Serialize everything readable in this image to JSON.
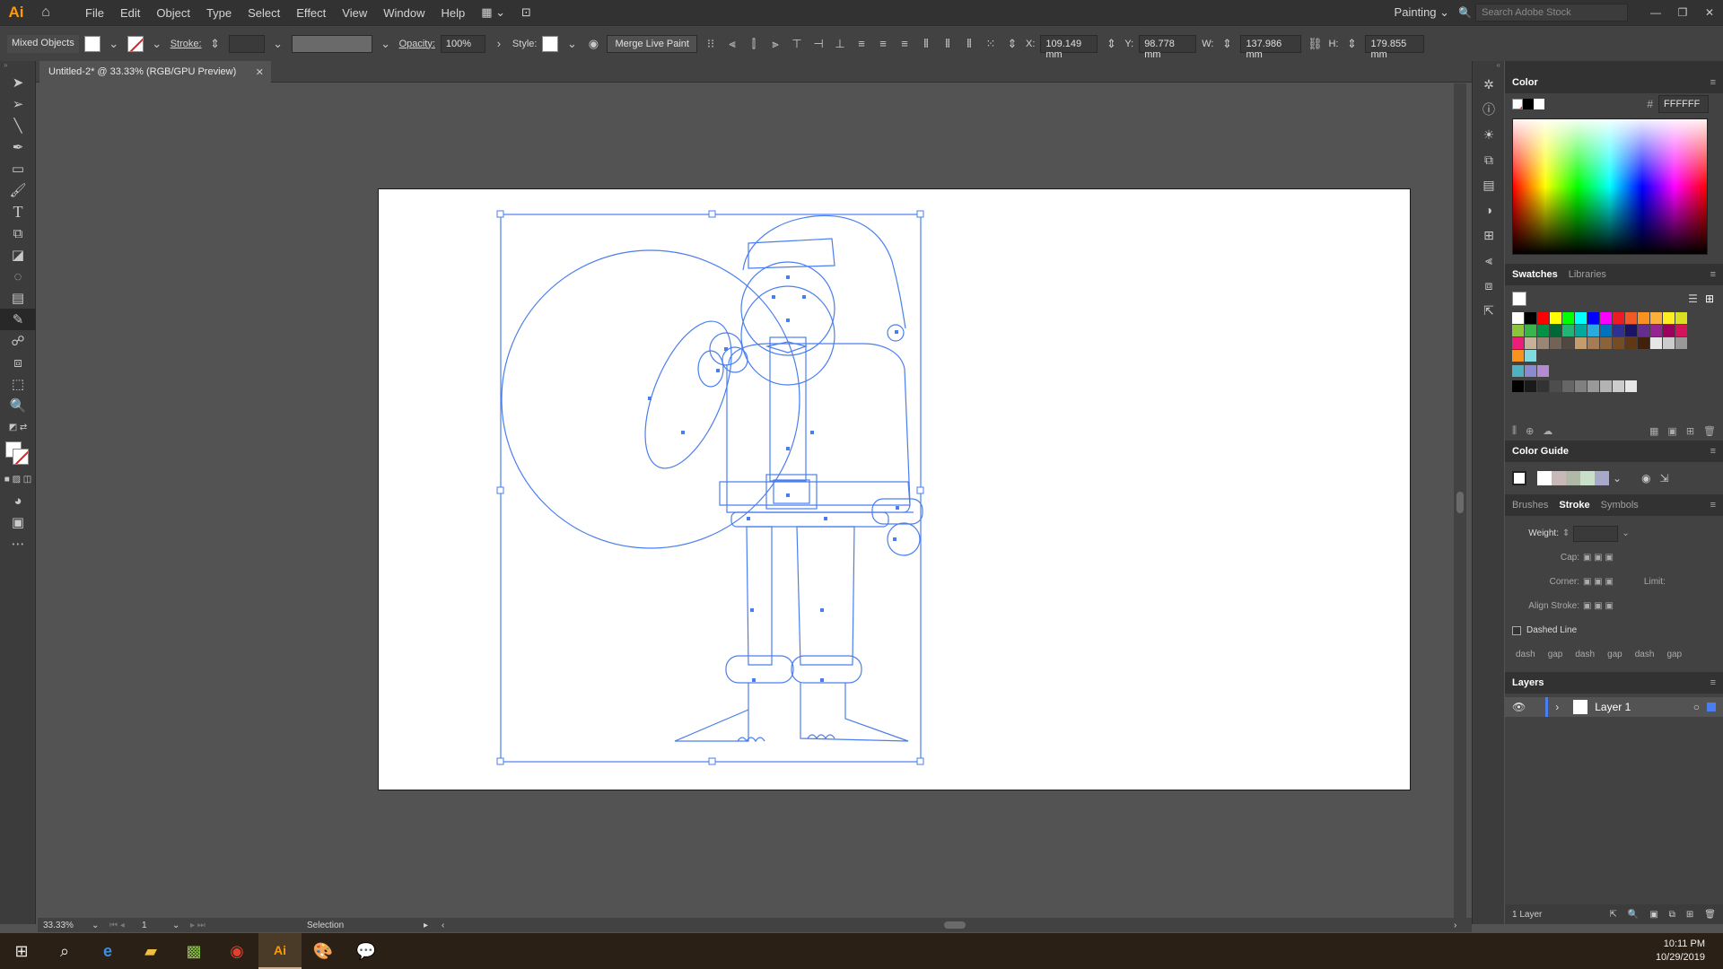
{
  "app": {
    "logo_text": "Ai",
    "menu": [
      "File",
      "Edit",
      "Object",
      "Type",
      "Select",
      "Effect",
      "View",
      "Window",
      "Help"
    ],
    "workspace": "Painting",
    "search_placeholder": "Search Adobe Stock"
  },
  "control_bar": {
    "selection_type": "Mixed Objects",
    "stroke_label": "Stroke:",
    "opacity_label": "Opacity:",
    "opacity_value": "100%",
    "style_label": "Style:",
    "merge_button": "Merge Live Paint",
    "x_label": "X:",
    "x_value": "109.149 mm",
    "y_label": "Y:",
    "y_value": "98.778 mm",
    "w_label": "W:",
    "w_value": "137.986 mm",
    "h_label": "H:",
    "h_value": "179.855 mm"
  },
  "document": {
    "tab_title": "Untitled-2* @ 33.33% (RGB/GPU Preview)",
    "zoom": "33.33%",
    "artboard_number": "1",
    "status_tool": "Selection"
  },
  "color_panel": {
    "title": "Color",
    "hex_label": "#",
    "hex_value": "FFFFFF"
  },
  "swatches_panel": {
    "tabs": [
      "Swatches",
      "Libraries"
    ],
    "colors": [
      "#ffffff",
      "#000000",
      "#ff0000",
      "#ffff00",
      "#00ff00",
      "#00ffff",
      "#0000ff",
      "#ff00ff",
      "#ed1c24",
      "#f15a24",
      "#f7931e",
      "#fbb03b",
      "#fcee21",
      "#d9e021",
      "#8cc63f",
      "#39b54a",
      "#009245",
      "#006837",
      "#22b573",
      "#00a99d",
      "#29abe2",
      "#0071bc",
      "#2e3192",
      "#1b1464",
      "#662d91",
      "#93278f",
      "#9e005d",
      "#d4145a",
      "#ed1e79",
      "#c7b299",
      "#998675",
      "#736357",
      "#534741",
      "#c69c6d",
      "#a67c52",
      "#8c6239",
      "#754c24",
      "#603813",
      "#42210b",
      "#e6e6e6",
      "#cccccc",
      "#999999",
      "#f7931e",
      "#7fdbe0"
    ],
    "group_colors": [
      "#4fb3bf",
      "#8a8ad0",
      "#b48ad0"
    ],
    "grays": [
      "#000000",
      "#1a1a1a",
      "#333333",
      "#4d4d4d",
      "#666666",
      "#808080",
      "#999999",
      "#b3b3b3",
      "#cccccc",
      "#e6e6e6"
    ]
  },
  "color_guide": {
    "title": "Color Guide",
    "harmony": [
      "#ffffff",
      "#c8b8b8",
      "#b0b8a8",
      "#c8e0c8",
      "#a8a8c8"
    ]
  },
  "stroke_panel": {
    "tabs": [
      "Brushes",
      "Stroke",
      "Symbols"
    ],
    "weight_label": "Weight:",
    "cap_label": "Cap:",
    "corner_label": "Corner:",
    "limit_label": "Limit:",
    "align_label": "Align Stroke:",
    "dashed_label": "Dashed Line",
    "dash_labels": [
      "dash",
      "gap",
      "dash",
      "gap",
      "dash",
      "gap"
    ]
  },
  "layers_panel": {
    "title": "Layers",
    "layer_name": "Layer 1",
    "count": "1 Layer"
  },
  "taskbar": {
    "time": "10:11 PM",
    "date": "10/29/2019"
  },
  "colors": {
    "selection": "#4a7ef0",
    "accent": "#ff9a00"
  }
}
